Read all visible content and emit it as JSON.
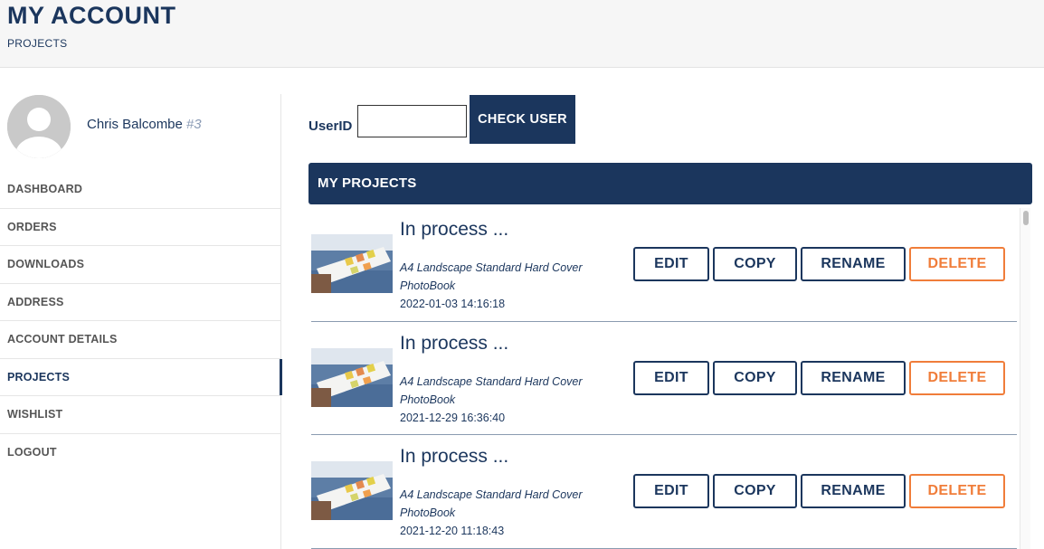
{
  "header": {
    "title": "MY ACCOUNT",
    "breadcrumb": "PROJECTS"
  },
  "user": {
    "name": "Chris Balcombe",
    "number": "#3"
  },
  "sidebar": {
    "items": [
      {
        "label": "DASHBOARD",
        "active": false
      },
      {
        "label": "ORDERS",
        "active": false
      },
      {
        "label": "DOWNLOADS",
        "active": false
      },
      {
        "label": "ADDRESS",
        "active": false
      },
      {
        "label": "ACCOUNT DETAILS",
        "active": false
      },
      {
        "label": "PROJECTS",
        "active": true
      },
      {
        "label": "WISHLIST",
        "active": false
      },
      {
        "label": "LOGOUT",
        "active": false
      }
    ]
  },
  "user_check": {
    "label": "UserID",
    "value": "",
    "button": "CHECK USER"
  },
  "projects": {
    "title": "MY PROJECTS",
    "items": [
      {
        "status": "In process ...",
        "description": "A4 Landscape Standard Hard Cover PhotoBook",
        "date": "2022-01-03 14:16:18"
      },
      {
        "status": "In process ...",
        "description": "A4 Landscape Standard Hard Cover PhotoBook",
        "date": "2021-12-29 16:36:40"
      },
      {
        "status": "In process ...",
        "description": "A4 Landscape Standard Hard Cover PhotoBook",
        "date": "2021-12-20 11:18:43"
      }
    ],
    "actions": {
      "edit": "EDIT",
      "copy": "COPY",
      "rename": "RENAME",
      "delete": "DELETE"
    }
  },
  "colors": {
    "primary": "#1b365d",
    "danger": "#f07d3a",
    "header_bg": "#f6f6f6"
  }
}
